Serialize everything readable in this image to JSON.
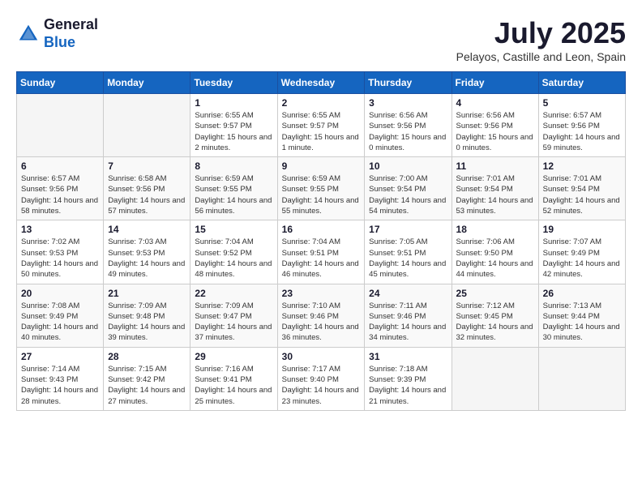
{
  "header": {
    "logo_line1": "General",
    "logo_line2": "Blue",
    "main_title": "July 2025",
    "subtitle": "Pelayos, Castille and Leon, Spain"
  },
  "calendar": {
    "columns": [
      "Sunday",
      "Monday",
      "Tuesday",
      "Wednesday",
      "Thursday",
      "Friday",
      "Saturday"
    ],
    "rows": [
      [
        {
          "day": "",
          "sunrise": "",
          "sunset": "",
          "daylight": ""
        },
        {
          "day": "",
          "sunrise": "",
          "sunset": "",
          "daylight": ""
        },
        {
          "day": "1",
          "sunrise": "Sunrise: 6:55 AM",
          "sunset": "Sunset: 9:57 PM",
          "daylight": "Daylight: 15 hours and 2 minutes."
        },
        {
          "day": "2",
          "sunrise": "Sunrise: 6:55 AM",
          "sunset": "Sunset: 9:57 PM",
          "daylight": "Daylight: 15 hours and 1 minute."
        },
        {
          "day": "3",
          "sunrise": "Sunrise: 6:56 AM",
          "sunset": "Sunset: 9:56 PM",
          "daylight": "Daylight: 15 hours and 0 minutes."
        },
        {
          "day": "4",
          "sunrise": "Sunrise: 6:56 AM",
          "sunset": "Sunset: 9:56 PM",
          "daylight": "Daylight: 15 hours and 0 minutes."
        },
        {
          "day": "5",
          "sunrise": "Sunrise: 6:57 AM",
          "sunset": "Sunset: 9:56 PM",
          "daylight": "Daylight: 14 hours and 59 minutes."
        }
      ],
      [
        {
          "day": "6",
          "sunrise": "Sunrise: 6:57 AM",
          "sunset": "Sunset: 9:56 PM",
          "daylight": "Daylight: 14 hours and 58 minutes."
        },
        {
          "day": "7",
          "sunrise": "Sunrise: 6:58 AM",
          "sunset": "Sunset: 9:56 PM",
          "daylight": "Daylight: 14 hours and 57 minutes."
        },
        {
          "day": "8",
          "sunrise": "Sunrise: 6:59 AM",
          "sunset": "Sunset: 9:55 PM",
          "daylight": "Daylight: 14 hours and 56 minutes."
        },
        {
          "day": "9",
          "sunrise": "Sunrise: 6:59 AM",
          "sunset": "Sunset: 9:55 PM",
          "daylight": "Daylight: 14 hours and 55 minutes."
        },
        {
          "day": "10",
          "sunrise": "Sunrise: 7:00 AM",
          "sunset": "Sunset: 9:54 PM",
          "daylight": "Daylight: 14 hours and 54 minutes."
        },
        {
          "day": "11",
          "sunrise": "Sunrise: 7:01 AM",
          "sunset": "Sunset: 9:54 PM",
          "daylight": "Daylight: 14 hours and 53 minutes."
        },
        {
          "day": "12",
          "sunrise": "Sunrise: 7:01 AM",
          "sunset": "Sunset: 9:54 PM",
          "daylight": "Daylight: 14 hours and 52 minutes."
        }
      ],
      [
        {
          "day": "13",
          "sunrise": "Sunrise: 7:02 AM",
          "sunset": "Sunset: 9:53 PM",
          "daylight": "Daylight: 14 hours and 50 minutes."
        },
        {
          "day": "14",
          "sunrise": "Sunrise: 7:03 AM",
          "sunset": "Sunset: 9:53 PM",
          "daylight": "Daylight: 14 hours and 49 minutes."
        },
        {
          "day": "15",
          "sunrise": "Sunrise: 7:04 AM",
          "sunset": "Sunset: 9:52 PM",
          "daylight": "Daylight: 14 hours and 48 minutes."
        },
        {
          "day": "16",
          "sunrise": "Sunrise: 7:04 AM",
          "sunset": "Sunset: 9:51 PM",
          "daylight": "Daylight: 14 hours and 46 minutes."
        },
        {
          "day": "17",
          "sunrise": "Sunrise: 7:05 AM",
          "sunset": "Sunset: 9:51 PM",
          "daylight": "Daylight: 14 hours and 45 minutes."
        },
        {
          "day": "18",
          "sunrise": "Sunrise: 7:06 AM",
          "sunset": "Sunset: 9:50 PM",
          "daylight": "Daylight: 14 hours and 44 minutes."
        },
        {
          "day": "19",
          "sunrise": "Sunrise: 7:07 AM",
          "sunset": "Sunset: 9:49 PM",
          "daylight": "Daylight: 14 hours and 42 minutes."
        }
      ],
      [
        {
          "day": "20",
          "sunrise": "Sunrise: 7:08 AM",
          "sunset": "Sunset: 9:49 PM",
          "daylight": "Daylight: 14 hours and 40 minutes."
        },
        {
          "day": "21",
          "sunrise": "Sunrise: 7:09 AM",
          "sunset": "Sunset: 9:48 PM",
          "daylight": "Daylight: 14 hours and 39 minutes."
        },
        {
          "day": "22",
          "sunrise": "Sunrise: 7:09 AM",
          "sunset": "Sunset: 9:47 PM",
          "daylight": "Daylight: 14 hours and 37 minutes."
        },
        {
          "day": "23",
          "sunrise": "Sunrise: 7:10 AM",
          "sunset": "Sunset: 9:46 PM",
          "daylight": "Daylight: 14 hours and 36 minutes."
        },
        {
          "day": "24",
          "sunrise": "Sunrise: 7:11 AM",
          "sunset": "Sunset: 9:46 PM",
          "daylight": "Daylight: 14 hours and 34 minutes."
        },
        {
          "day": "25",
          "sunrise": "Sunrise: 7:12 AM",
          "sunset": "Sunset: 9:45 PM",
          "daylight": "Daylight: 14 hours and 32 minutes."
        },
        {
          "day": "26",
          "sunrise": "Sunrise: 7:13 AM",
          "sunset": "Sunset: 9:44 PM",
          "daylight": "Daylight: 14 hours and 30 minutes."
        }
      ],
      [
        {
          "day": "27",
          "sunrise": "Sunrise: 7:14 AM",
          "sunset": "Sunset: 9:43 PM",
          "daylight": "Daylight: 14 hours and 28 minutes."
        },
        {
          "day": "28",
          "sunrise": "Sunrise: 7:15 AM",
          "sunset": "Sunset: 9:42 PM",
          "daylight": "Daylight: 14 hours and 27 minutes."
        },
        {
          "day": "29",
          "sunrise": "Sunrise: 7:16 AM",
          "sunset": "Sunset: 9:41 PM",
          "daylight": "Daylight: 14 hours and 25 minutes."
        },
        {
          "day": "30",
          "sunrise": "Sunrise: 7:17 AM",
          "sunset": "Sunset: 9:40 PM",
          "daylight": "Daylight: 14 hours and 23 minutes."
        },
        {
          "day": "31",
          "sunrise": "Sunrise: 7:18 AM",
          "sunset": "Sunset: 9:39 PM",
          "daylight": "Daylight: 14 hours and 21 minutes."
        },
        {
          "day": "",
          "sunrise": "",
          "sunset": "",
          "daylight": ""
        },
        {
          "day": "",
          "sunrise": "",
          "sunset": "",
          "daylight": ""
        }
      ]
    ]
  }
}
